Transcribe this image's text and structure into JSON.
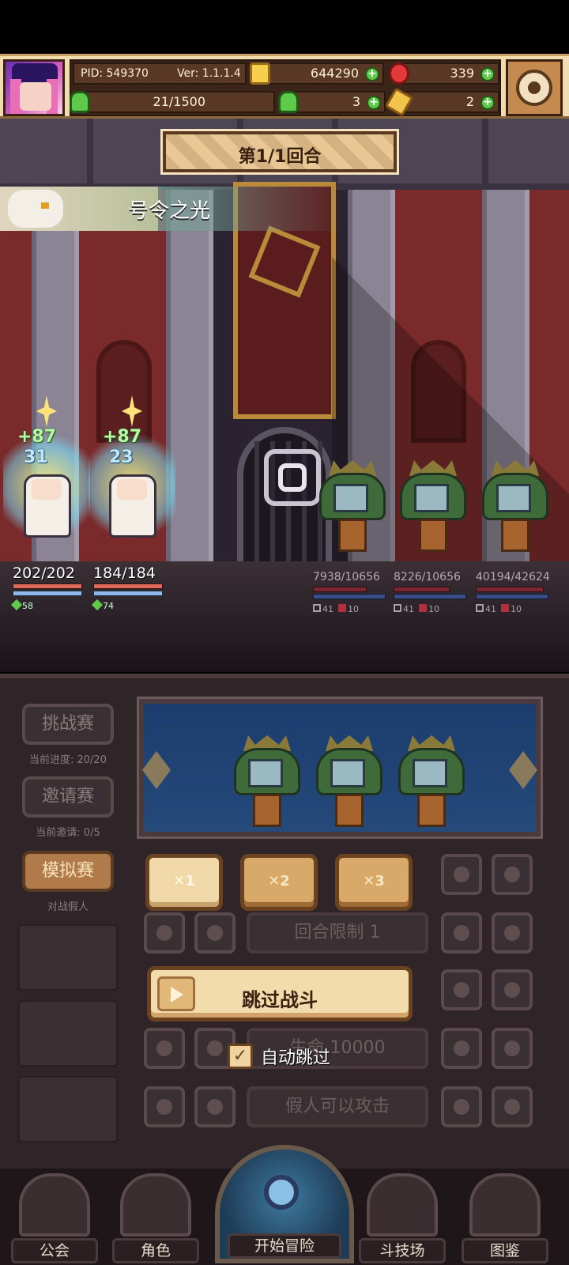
{
  "hud": {
    "pid": "PID: 549370",
    "version": "Ver: 1.1.1.4",
    "gold": "644290",
    "rubies": "339",
    "stamina": "21/1500",
    "clovers": "3",
    "keys": "2"
  },
  "battle": {
    "round_label": "第1/1回合",
    "skill_name": "号令之光",
    "heroes": [
      {
        "hp": "202/202",
        "heal": "+87",
        "shield": "31",
        "speed": "58"
      },
      {
        "hp": "184/184",
        "heal": "+87",
        "shield": "23",
        "speed": "74"
      }
    ],
    "enemies": [
      {
        "hp": "7938/10656",
        "atk": "41",
        "def": "10"
      },
      {
        "hp": "8226/10656",
        "atk": "41",
        "def": "10"
      },
      {
        "hp": "40194/42624",
        "atk": "41",
        "def": "10"
      }
    ]
  },
  "panel": {
    "challenge_btn": "挑战赛",
    "challenge_progress": "当前进度: 20/20",
    "invite_btn": "邀请赛",
    "invite_status": "当前邀请: 0/5",
    "sim_btn": "模拟赛",
    "sim_caption": "对战假人",
    "speed_x1": "✕1",
    "speed_x2": "✕2",
    "speed_x3": "✕3",
    "round_limit": "回合限制 1",
    "hp_setting": "生命 10000",
    "dummy_attack": "假人可以攻击",
    "skip_battle": "跳过战斗",
    "auto_skip": "自动跳过",
    "auto_skip_checked": true
  },
  "nav": {
    "guild": "公会",
    "character": "角色",
    "adventure": "开始冒险",
    "arena": "斗技场",
    "codex": "图鉴"
  }
}
